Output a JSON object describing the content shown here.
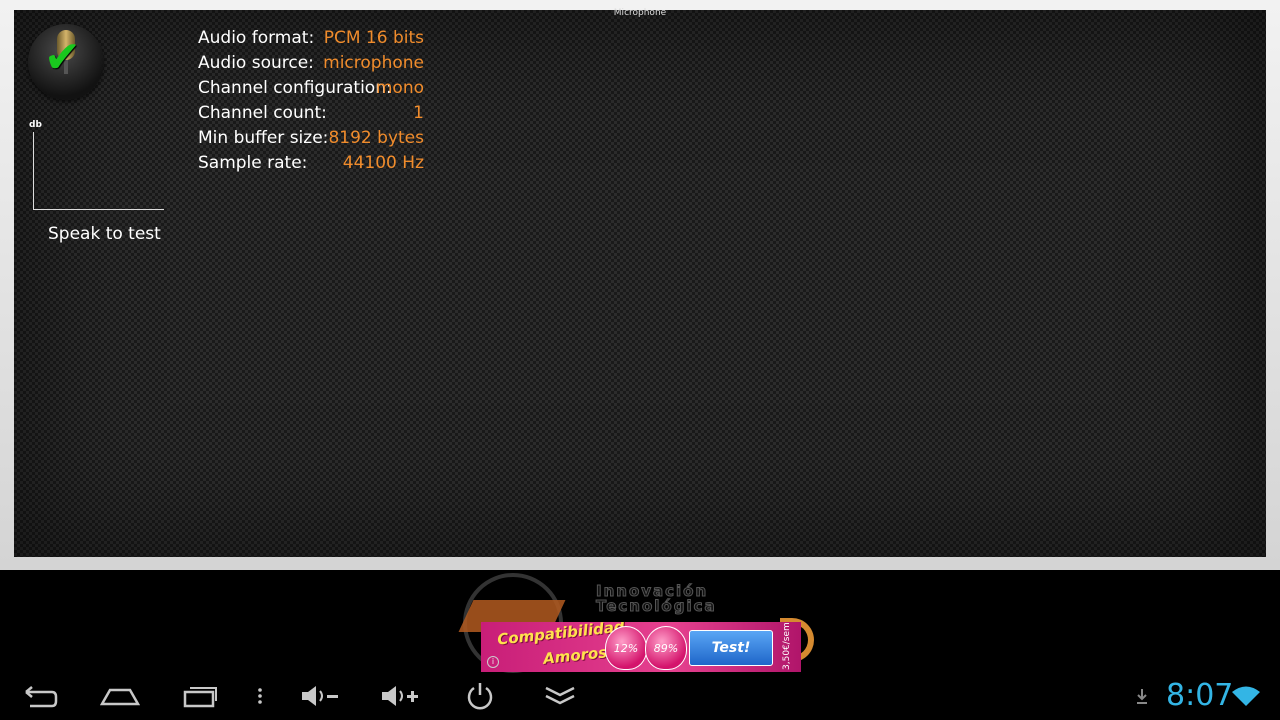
{
  "window": {
    "title": "Microphone"
  },
  "meter": {
    "unit_label": "db",
    "hint": "Speak to test"
  },
  "properties": [
    {
      "label": "Audio format:",
      "value": "PCM 16 bits"
    },
    {
      "label": "Audio source:",
      "value": "microphone"
    },
    {
      "label": "Channel configuration:",
      "value": "mono"
    },
    {
      "label": "Channel count:",
      "value": "1"
    },
    {
      "label": "Min buffer size:",
      "value": "8192 bytes"
    },
    {
      "label": "Sample rate:",
      "value": "44100 Hz"
    }
  ],
  "logo": {
    "line1": "Innovación",
    "line2": "Tecnológica"
  },
  "ad": {
    "title": "Compatibilidad",
    "subtitle": "Amorosa",
    "heart1": "12%",
    "heart2": "89%",
    "button": "Test!",
    "price": "3,50€/sem.",
    "info": "i"
  },
  "status": {
    "time": "8:07"
  },
  "colors": {
    "accent_value": "#f08c2c",
    "clock": "#33b5e5",
    "ad_pink": "#e6418f",
    "ad_button": "#1f66c9"
  },
  "nav_icons": [
    "back-icon",
    "home-icon",
    "recent-apps-icon",
    "overflow-menu-icon",
    "volume-down-icon",
    "volume-up-icon",
    "power-icon",
    "collapse-icon",
    "download-icon",
    "wifi-icon"
  ]
}
